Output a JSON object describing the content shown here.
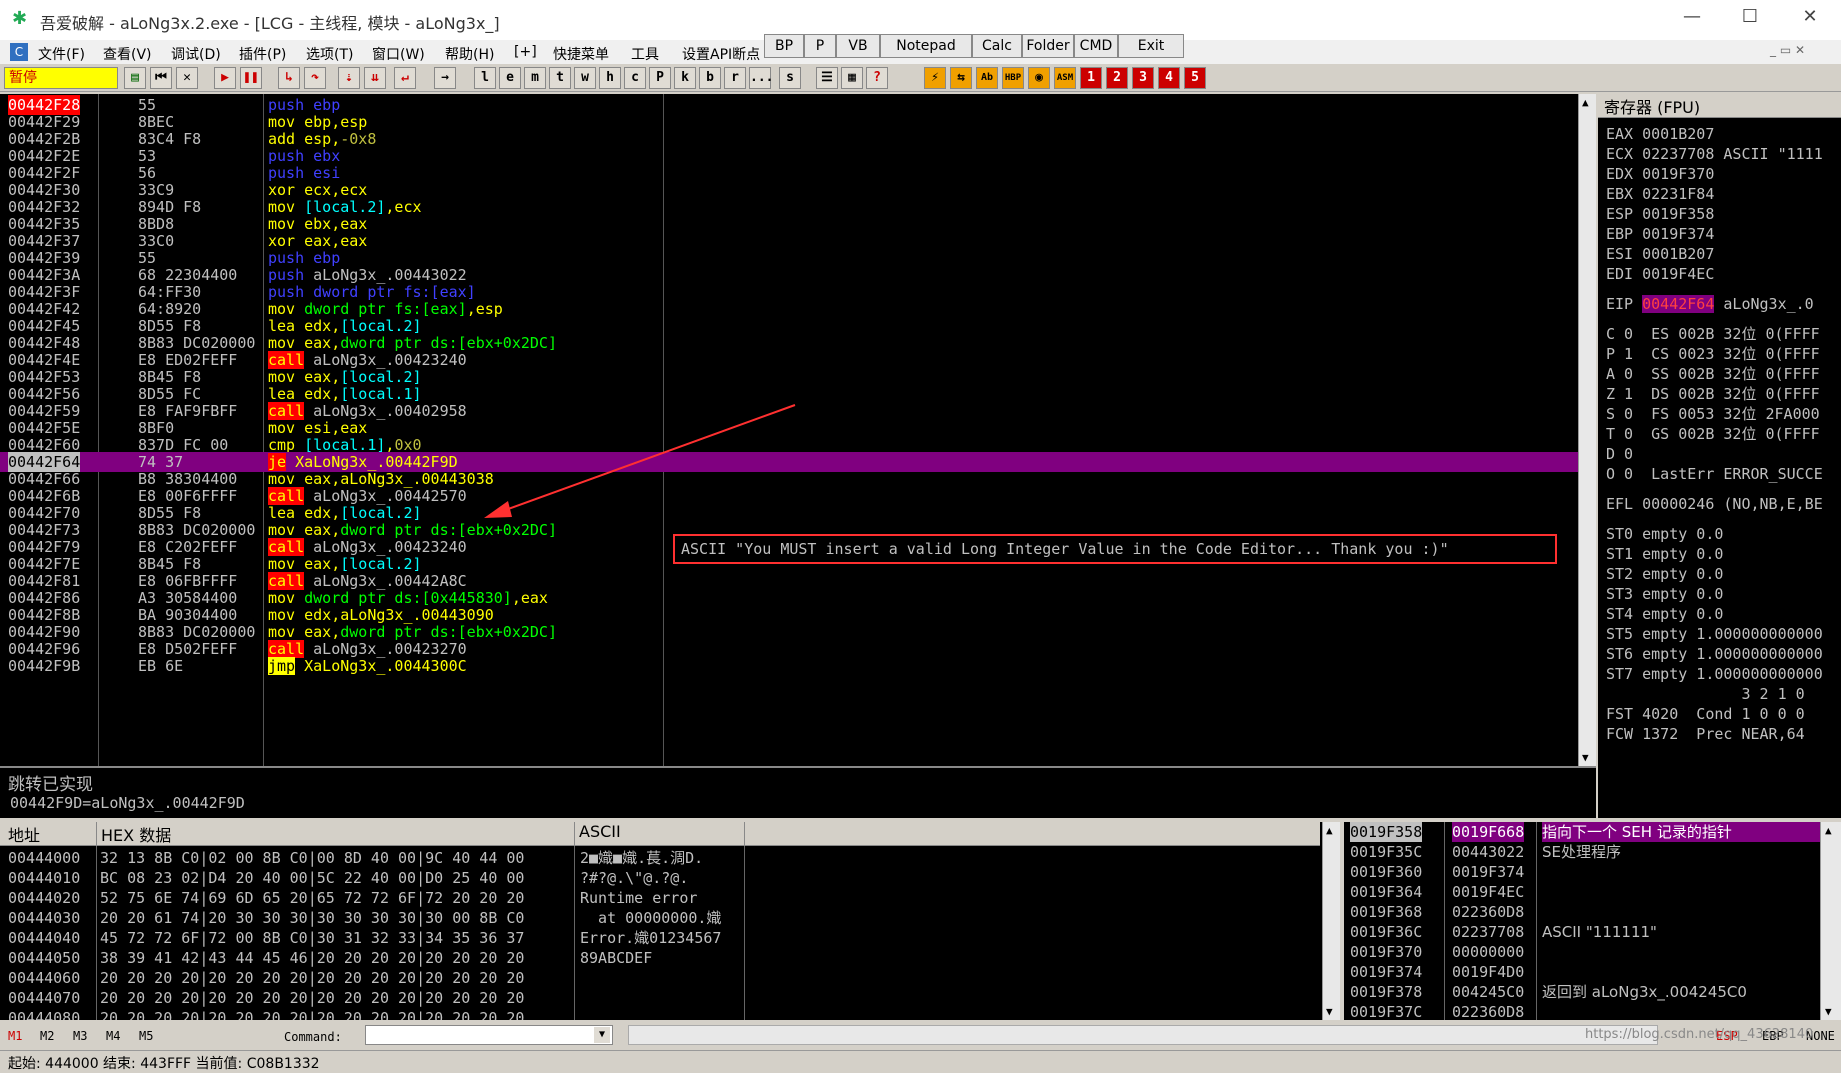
{
  "window": {
    "title": "吾爱破解 - aLoNg3x.2.exe - [LCG - 主线程, 模块 - aLoNg3x_]",
    "min": "—",
    "max": "☐",
    "close": "✕"
  },
  "menu": [
    "文件(F)",
    "查看(V)",
    "调试(D)",
    "插件(P)",
    "选项(T)",
    "窗口(W)",
    "帮助(H)",
    "[+]",
    "快捷菜单",
    "工具",
    "设置API断点"
  ],
  "quick_buttons": [
    "BP",
    "P",
    "VB",
    "Notepad",
    "Calc",
    "Folder",
    "CMD",
    "Exit"
  ],
  "toolbar": {
    "status": "暂停",
    "letters": [
      "l",
      "e",
      "m",
      "t",
      "w",
      "h",
      "c",
      "P",
      "k",
      "b",
      "r",
      "...",
      "s"
    ],
    "numbers": [
      "1",
      "2",
      "3",
      "4",
      "5"
    ]
  },
  "disasm": [
    {
      "addr": "00442F28",
      "hex": "55",
      "asm": [
        [
          "b",
          "push ebp"
        ]
      ],
      "hl": "addr"
    },
    {
      "addr": "00442F29",
      "hex": "8BEC",
      "asm": [
        [
          "y",
          "mov ebp,esp"
        ]
      ]
    },
    {
      "addr": "00442F2B",
      "hex": "83C4 F8",
      "asm": [
        [
          "y",
          "add esp,"
        ],
        [
          "o",
          "-0x8"
        ]
      ]
    },
    {
      "addr": "00442F2E",
      "hex": "53",
      "asm": [
        [
          "b",
          "push ebx"
        ]
      ]
    },
    {
      "addr": "00442F2F",
      "hex": "56",
      "asm": [
        [
          "b",
          "push esi"
        ]
      ]
    },
    {
      "addr": "00442F30",
      "hex": "33C9",
      "asm": [
        [
          "y",
          "xor ecx,ecx"
        ]
      ]
    },
    {
      "addr": "00442F32",
      "hex": "894D F8",
      "asm": [
        [
          "y",
          "mov "
        ],
        [
          "cy",
          "[local.2]"
        ],
        [
          "y",
          ",ecx"
        ]
      ]
    },
    {
      "addr": "00442F35",
      "hex": "8BD8",
      "asm": [
        [
          "y",
          "mov ebx,eax"
        ]
      ]
    },
    {
      "addr": "00442F37",
      "hex": "33C0",
      "asm": [
        [
          "y",
          "xor eax,eax"
        ]
      ]
    },
    {
      "addr": "00442F39",
      "hex": "55",
      "asm": [
        [
          "b",
          "push ebp"
        ]
      ]
    },
    {
      "addr": "00442F3A",
      "hex": "68 22304400",
      "asm": [
        [
          "b",
          "push "
        ],
        [
          "w",
          "aLoNg3x_.00443022"
        ]
      ]
    },
    {
      "addr": "00442F3F",
      "hex": "64:FF30",
      "asm": [
        [
          "b",
          "push dword ptr fs:[eax]"
        ]
      ]
    },
    {
      "addr": "00442F42",
      "hex": "64:8920",
      "asm": [
        [
          "y",
          "mov "
        ],
        [
          "g",
          "dword ptr fs:[eax]"
        ],
        [
          "y",
          ",esp"
        ]
      ]
    },
    {
      "addr": "00442F45",
      "hex": "8D55 F8",
      "asm": [
        [
          "y",
          "lea edx,"
        ],
        [
          "cy",
          "[local.2]"
        ]
      ]
    },
    {
      "addr": "00442F48",
      "hex": "8B83 DC020000",
      "asm": [
        [
          "y",
          "mov eax,"
        ],
        [
          "g",
          "dword ptr ds:[ebx+0x2DC]"
        ]
      ]
    },
    {
      "addr": "00442F4E",
      "hex": "E8 ED02FEFF",
      "asm": [
        [
          "call",
          "call"
        ],
        [
          "w",
          " aLoNg3x_.00423240"
        ]
      ]
    },
    {
      "addr": "00442F53",
      "hex": "8B45 F8",
      "asm": [
        [
          "y",
          "mov eax,"
        ],
        [
          "cy",
          "[local.2]"
        ]
      ]
    },
    {
      "addr": "00442F56",
      "hex": "8D55 FC",
      "asm": [
        [
          "y",
          "lea edx,"
        ],
        [
          "cy",
          "[local.1]"
        ]
      ]
    },
    {
      "addr": "00442F59",
      "hex": "E8 FAF9FBFF",
      "asm": [
        [
          "call",
          "call"
        ],
        [
          "w",
          " aLoNg3x_.00402958"
        ]
      ]
    },
    {
      "addr": "00442F5E",
      "hex": "8BF0",
      "asm": [
        [
          "y",
          "mov esi,eax"
        ]
      ]
    },
    {
      "addr": "00442F60",
      "hex": "837D FC 00",
      "asm": [
        [
          "y",
          "cmp "
        ],
        [
          "cy",
          "[local.1]"
        ],
        [
          "y",
          ","
        ],
        [
          "o",
          "0x0"
        ]
      ]
    },
    {
      "addr": "00442F64",
      "hex": "74 37",
      "asm": [
        [
          "je",
          "je"
        ],
        [
          "y",
          " XaLoNg3x_.00442F9D"
        ]
      ],
      "hl": "row"
    },
    {
      "addr": "00442F66",
      "hex": "B8 38304400",
      "asm": [
        [
          "y",
          "mov eax,aLoNg3x_.00443038"
        ]
      ]
    },
    {
      "addr": "00442F6B",
      "hex": "E8 00F6FFFF",
      "asm": [
        [
          "call",
          "call"
        ],
        [
          "w",
          " aLoNg3x_.00442570"
        ]
      ]
    },
    {
      "addr": "00442F70",
      "hex": "8D55 F8",
      "asm": [
        [
          "y",
          "lea edx,"
        ],
        [
          "cy",
          "[local.2]"
        ]
      ]
    },
    {
      "addr": "00442F73",
      "hex": "8B83 DC020000",
      "asm": [
        [
          "y",
          "mov eax,"
        ],
        [
          "g",
          "dword ptr ds:[ebx+0x2DC]"
        ]
      ]
    },
    {
      "addr": "00442F79",
      "hex": "E8 C202FEFF",
      "asm": [
        [
          "call",
          "call"
        ],
        [
          "w",
          " aLoNg3x_.00423240"
        ]
      ]
    },
    {
      "addr": "00442F7E",
      "hex": "8B45 F8",
      "asm": [
        [
          "y",
          "mov eax,"
        ],
        [
          "cy",
          "[local.2]"
        ]
      ]
    },
    {
      "addr": "00442F81",
      "hex": "E8 06FBFFFF",
      "asm": [
        [
          "call",
          "call"
        ],
        [
          "w",
          " aLoNg3x_.00442A8C"
        ]
      ]
    },
    {
      "addr": "00442F86",
      "hex": "A3 30584400",
      "asm": [
        [
          "y",
          "mov "
        ],
        [
          "g",
          "dword ptr ds:[0x445830]"
        ],
        [
          "y",
          ",eax"
        ]
      ]
    },
    {
      "addr": "00442F8B",
      "hex": "BA 90304400",
      "asm": [
        [
          "y",
          "mov edx,aLoNg3x_.00443090"
        ]
      ]
    },
    {
      "addr": "00442F90",
      "hex": "8B83 DC020000",
      "asm": [
        [
          "y",
          "mov eax,"
        ],
        [
          "g",
          "dword ptr ds:[ebx+0x2DC]"
        ]
      ]
    },
    {
      "addr": "00442F96",
      "hex": "E8 D502FEFF",
      "asm": [
        [
          "call",
          "call"
        ],
        [
          "w",
          " aLoNg3x_.00423270"
        ]
      ]
    },
    {
      "addr": "00442F9B",
      "hex": "EB 6E",
      "asm": [
        [
          "jmp",
          "jmp"
        ],
        [
          "y",
          " XaLoNg3x_.0044300C"
        ]
      ]
    }
  ],
  "comment": "ASCII \"You MUST insert a valid Long Integer Value in the Code Editor... Thank you :)\"",
  "info": {
    "line1": "跳转已实现",
    "line2": "00442F9D=aLoNg3x_.00442F9D"
  },
  "registers": {
    "title": "寄存器 (FPU)",
    "lines": [
      "EAX 0001B207",
      "ECX 02237708 ASCII \"1111",
      "EDX 0019F370",
      "EBX 02231F84",
      "ESP 0019F358",
      "EBP 0019F374",
      "ESI 0001B207",
      "EDI 0019F4EC"
    ],
    "eip_label": "EIP",
    "eip_val": "00442F64",
    "eip_rest": " aLoNg3x_.0",
    "flags": [
      "C 0  ES 002B 32位 0(FFFF",
      "P 1  CS 0023 32位 0(FFFF",
      "A 0  SS 002B 32位 0(FFFF",
      "Z 1  DS 002B 32位 0(FFFF",
      "S 0  FS 0053 32位 2FA000",
      "T 0  GS 002B 32位 0(FFFF",
      "D 0",
      "O 0  LastErr ERROR_SUCCE"
    ],
    "efl": "EFL 00000246 (NO,NB,E,BE",
    "fpu": [
      "ST0 empty 0.0",
      "ST1 empty 0.0",
      "ST2 empty 0.0",
      "ST3 empty 0.0",
      "ST4 empty 0.0",
      "ST5 empty 1.000000000000",
      "ST6 empty 1.000000000000",
      "ST7 empty 1.000000000000",
      "               3 2 1 0",
      "FST 4020  Cond 1 0 0 0",
      "FCW 1372  Prec NEAR,64"
    ]
  },
  "dump": {
    "h_addr": "地址",
    "h_hex": "HEX 数据",
    "h_ascii": "ASCII",
    "rows": [
      {
        "a": "00444000",
        "h": "32 13 8B C0|02 00 8B C0|00 8D 40 00|9C 40 44 00",
        "s": "2■嬂■嬂.萇.淍D."
      },
      {
        "a": "00444010",
        "h": "BC 08 23 02|D4 20 40 00|5C 22 40 00|D0 25 40 00",
        "s": "?#?@.\\\"@.?@."
      },
      {
        "a": "00444020",
        "h": "52 75 6E 74|69 6D 65 20|65 72 72 6F|72 20 20 20",
        "s": "Runtime error"
      },
      {
        "a": "00444030",
        "h": "20 20 61 74|20 30 30 30|30 30 30 30|30 00 8B C0",
        "s": "  at 00000000.嬂"
      },
      {
        "a": "00444040",
        "h": "45 72 72 6F|72 00 8B C0|30 31 32 33|34 35 36 37",
        "s": "Error.嬂01234567"
      },
      {
        "a": "00444050",
        "h": "38 39 41 42|43 44 45 46|20 20 20 20|20 20 20 20",
        "s": "89ABCDEF"
      },
      {
        "a": "00444060",
        "h": "20 20 20 20|20 20 20 20|20 20 20 20|20 20 20 20",
        "s": ""
      },
      {
        "a": "00444070",
        "h": "20 20 20 20|20 20 20 20|20 20 20 20|20 20 20 20",
        "s": ""
      },
      {
        "a": "00444080",
        "h": "20 20 20 20|20 20 20 20|20 20 20 20|20 20 20 20",
        "s": ""
      }
    ]
  },
  "stack": {
    "rows": [
      {
        "a": "0019F358",
        "v": "0019F668",
        "c": "指向下一个 SEH 记录的指针",
        "hl": true
      },
      {
        "a": "0019F35C",
        "v": "00443022",
        "c": "SE处理程序"
      },
      {
        "a": "0019F360",
        "v": "0019F374",
        "c": ""
      },
      {
        "a": "0019F364",
        "v": "0019F4EC",
        "c": ""
      },
      {
        "a": "0019F368",
        "v": "022360D8",
        "c": ""
      },
      {
        "a": "0019F36C",
        "v": "02237708",
        "c": "ASCII \"111111\""
      },
      {
        "a": "0019F370",
        "v": "00000000",
        "c": ""
      },
      {
        "a": "0019F374",
        "v": "0019F4D0",
        "c": ""
      },
      {
        "a": "0019F378",
        "v": "004245C0",
        "c": "返回到 aLoNg3x_.004245C0"
      },
      {
        "a": "0019F37C",
        "v": "022360D8",
        "c": ""
      }
    ]
  },
  "cmdbar": {
    "tabs": [
      "M1",
      "M2",
      "M3",
      "M4",
      "M5"
    ],
    "label": "Command:",
    "right": [
      "ESP",
      "EBP",
      "NONE"
    ]
  },
  "status": "起始: 444000 结束: 443FFF 当前值: C08B1332",
  "watermark": "https://blog.csdn.net/qq_43628140",
  "colors": {
    "highlight_row": "#800080",
    "addr_highlight": "#ff0000",
    "comment_box": "#ff3030",
    "arrow": "#ff3030"
  }
}
